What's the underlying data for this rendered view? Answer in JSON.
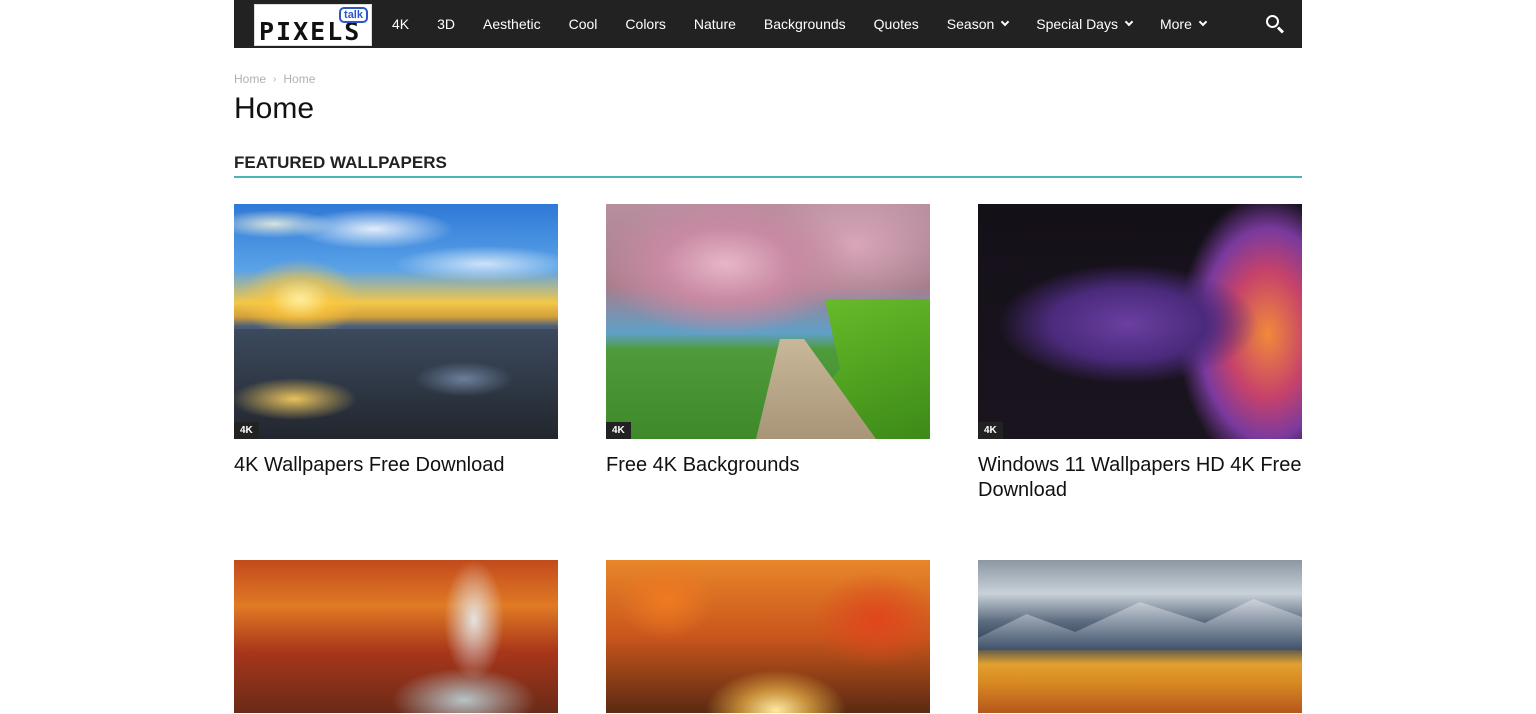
{
  "logo": {
    "main": "PIXELS",
    "badge": "talk"
  },
  "nav": {
    "items": [
      "4K",
      "3D",
      "Aesthetic",
      "Cool",
      "Colors",
      "Nature",
      "Backgrounds",
      "Quotes"
    ],
    "dropdowns": [
      "Season",
      "Special Days",
      "More"
    ]
  },
  "breadcrumb": {
    "items": [
      "Home",
      "Home"
    ],
    "separator": "›"
  },
  "page": {
    "title": "Home"
  },
  "section": {
    "title": "FEATURED WALLPAPERS",
    "accent_color": "#4db2b9"
  },
  "cards": [
    {
      "tag": "4K",
      "title": "4K Wallpapers Free Download",
      "image": "sunset-rocky-shore"
    },
    {
      "tag": "4K",
      "title": "Free 4K Backgrounds",
      "image": "cherry-blossom-path"
    },
    {
      "tag": "4K",
      "title": "Windows 11 Wallpapers HD 4K Free Download",
      "image": "abstract-purple-waves"
    },
    {
      "title": "",
      "image": "autumn-waterfall-forest"
    },
    {
      "title": "",
      "image": "autumn-leaves-sunlight"
    },
    {
      "title": "",
      "image": "autumn-trees-mountains"
    }
  ],
  "colors": {
    "topbar": "#222222",
    "link": "#111111",
    "breadcrumb": "#b0b0b0"
  },
  "icons": {
    "search": "search-icon",
    "dropdown": "chevron-down-icon"
  }
}
